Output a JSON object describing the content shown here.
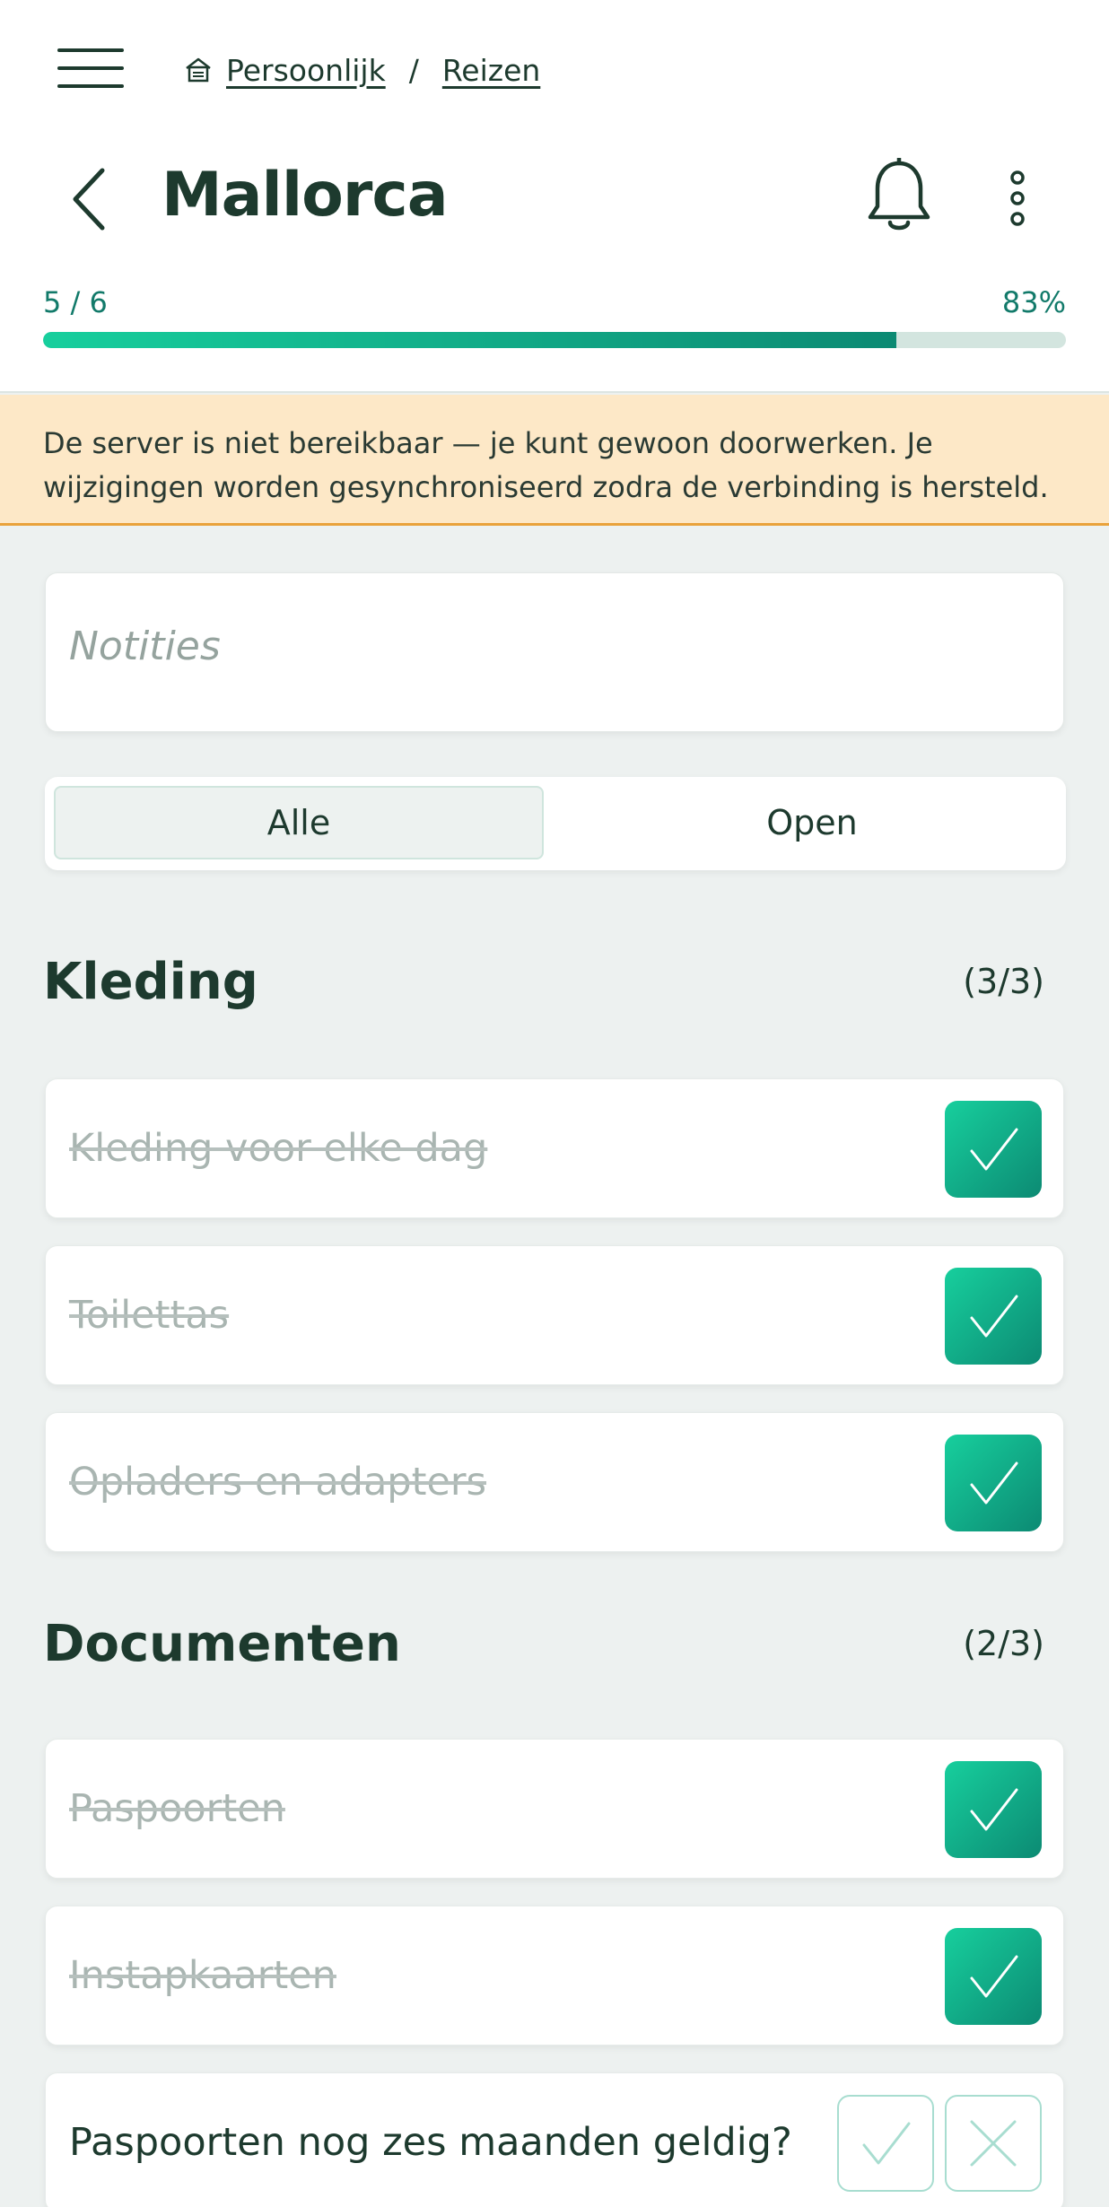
{
  "breadcrumb": {
    "home": "Persoonlijk",
    "separator": "/",
    "current": "Reizen"
  },
  "header": {
    "title": "Mallorca"
  },
  "progress": {
    "count_text": "5 / 6",
    "percent_text": "83%",
    "fraction": 0.834
  },
  "banner": {
    "text": "De server is niet bereikbaar — je kunt gewoon doorwerken. Je wijzigingen worden gesynchroniseerd zodra de verbinding is hersteld."
  },
  "notes": {
    "placeholder": "Notities"
  },
  "filter": {
    "all_label": "Alle",
    "open_label": "Open",
    "selected": "Alle"
  },
  "sections": [
    {
      "title": "Kleding",
      "count": "(3/3)",
      "items": [
        {
          "label": "Kleding voor elke dag",
          "done": true
        },
        {
          "label": "Toilettas",
          "done": true
        },
        {
          "label": "Opladers en adapters",
          "done": true
        }
      ]
    },
    {
      "title": "Documenten",
      "count": "(2/3)",
      "items": [
        {
          "label": "Paspoorten",
          "done": true
        },
        {
          "label": "Instapkaarten",
          "done": true
        },
        {
          "label": "Paspoorten nog zes maanden geldig?",
          "done": false
        }
      ]
    }
  ],
  "icons": {
    "menu": "hamburger-icon",
    "home": "home-icon",
    "back": "chevron-left-icon",
    "notifications": "bell-icon",
    "more": "more-vertical-icon",
    "checked": "check-icon",
    "reject": "close-icon"
  },
  "colors": {
    "accent_start": "#17cf9d",
    "accent_end": "#0c8a73",
    "text": "#1d3a2e",
    "banner_bg": "#fde8c7",
    "banner_border": "#e9a23b"
  }
}
